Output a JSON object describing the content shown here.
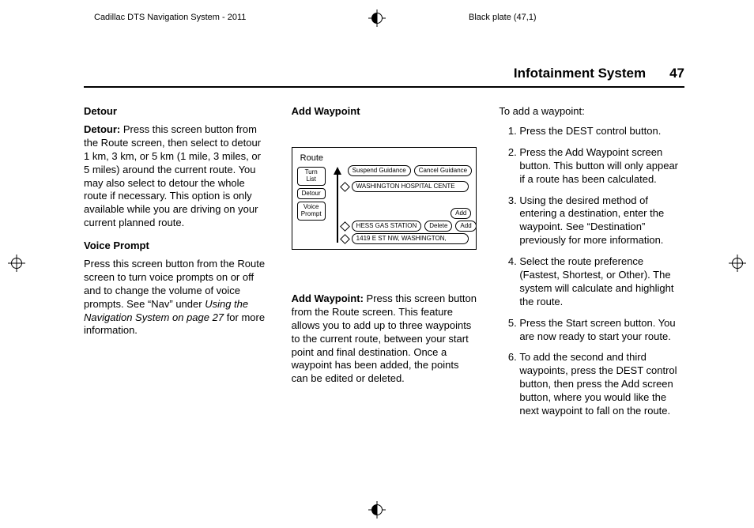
{
  "print": {
    "header_left": "Cadillac DTS Navigation System - 2011",
    "header_right": "Black plate (47,1)"
  },
  "running_head": {
    "section": "Infotainment System",
    "page": "47"
  },
  "col1": {
    "h1": "Detour",
    "detour_lead": "Detour:",
    "detour_body": "Press this screen button from the Route screen, then select to detour 1 km, 3 km, or 5 km (1 mile, 3 miles, or 5 miles) around the current route. You may also select to detour the whole route if necessary. This option is only available while you are driving on your current planned route.",
    "h2": "Voice Prompt",
    "voice_body_a": "Press this screen button from the Route screen to turn voice prompts on or off and to change the volume of voice prompts. See “Nav” under ",
    "voice_body_ital": "Using the Navigation System on page 27",
    "voice_body_b": " for more information."
  },
  "col2": {
    "h1": "Add Waypoint",
    "aw_lead": "Add Waypoint:",
    "aw_body": "Press this screen button from the Route screen. This feature allows you to add up to three waypoints to the current route, between your start point and final destination. Once a waypoint has been added, the points can be edited or deleted."
  },
  "nav": {
    "title": "Route",
    "side": [
      "Turn List",
      "Detour",
      "Voice Prompt"
    ],
    "top_row": [
      "Suspend Guidance",
      "Cancel Guidance"
    ],
    "line1": "WASHINGTON HOSPITAL CENTE",
    "line2a": "HESS GAS STATION",
    "line2b": "Delete",
    "line2_add": "Add",
    "line3": "1419 E ST NW, WASHINGTON,",
    "line3_add": "Add"
  },
  "col3": {
    "lead": "To add a waypoint:",
    "steps": [
      "Press the DEST control button.",
      "Press the Add Waypoint screen button. This button will only appear if a route has been calculated.",
      "Using the desired method of entering a destination, enter the waypoint. See “Destination” previously for more information.",
      "Select the route preference (Fastest, Shortest, or Other). The system will calculate and highlight the route.",
      "Press the Start screen button. You are now ready to start your route.",
      "To add the second and third waypoints, press the DEST control button, then press the Add screen button, where you would like the next waypoint to fall on the route."
    ]
  }
}
